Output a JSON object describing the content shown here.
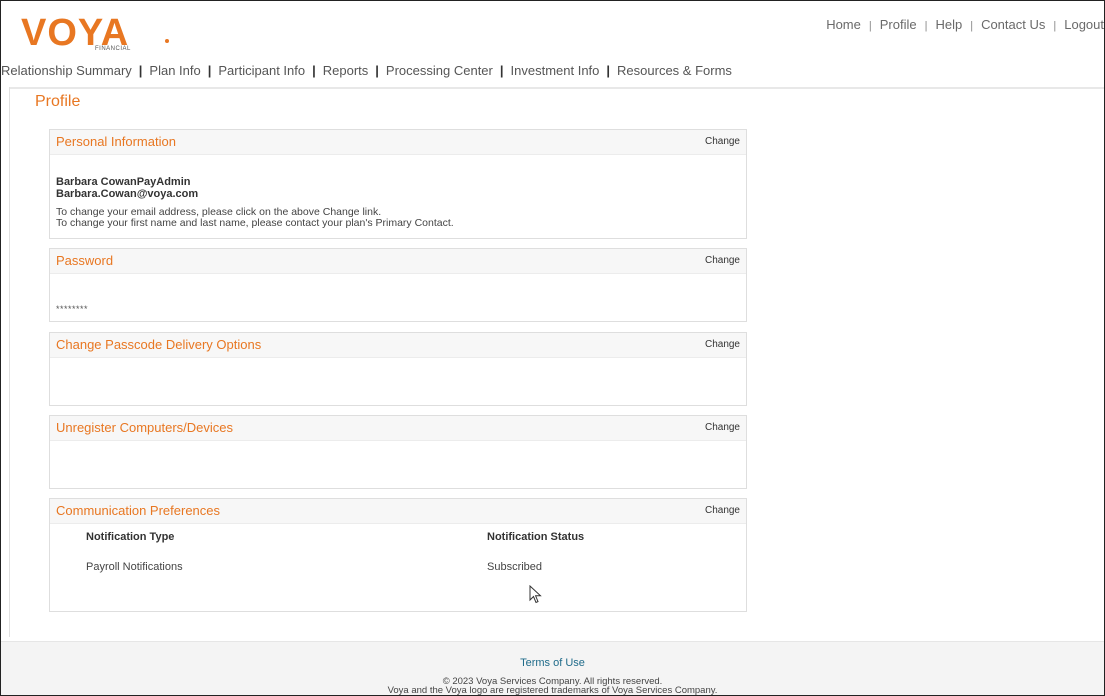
{
  "header": {
    "logo_text": "VOYA",
    "logo_sub": "FINANCIAL",
    "utility_nav": [
      "Home",
      "Profile",
      "Help",
      "Contact Us",
      "Logout"
    ],
    "main_nav": [
      "Relationship Summary",
      "Plan Info",
      "Participant Info",
      "Reports",
      "Processing Center",
      "Investment Info",
      "Resources & Forms"
    ]
  },
  "page": {
    "title": "Profile"
  },
  "sections": {
    "personal": {
      "title": "Personal Information",
      "change": "Change",
      "name": "Barbara CowanPayAdmin",
      "email": "Barbara.Cowan@voya.com",
      "note1": "To change your email address, please click on the above Change link.",
      "note2": "To change your first name and last name, please contact your plan's Primary Contact."
    },
    "password": {
      "title": "Password",
      "change": "Change",
      "mask": "********"
    },
    "passcode": {
      "title": "Change Passcode Delivery Options",
      "change": "Change"
    },
    "devices": {
      "title": "Unregister Computers/Devices",
      "change": "Change"
    },
    "communication": {
      "title": "Communication Preferences",
      "change": "Change",
      "col_type": "Notification Type",
      "col_status": "Notification Status",
      "rows": [
        {
          "type": "Payroll Notifications",
          "status": "Subscribed"
        }
      ]
    }
  },
  "footer": {
    "terms": "Terms of Use",
    "copyright": "© 2023 Voya Services Company. All rights reserved.",
    "trademark": "Voya and the Voya logo are registered trademarks of Voya Services Company."
  },
  "colors": {
    "brand_orange": "#e87722",
    "link_teal": "#1f6b8a"
  },
  "icons": {
    "cursor": "mouse-pointer-icon"
  }
}
